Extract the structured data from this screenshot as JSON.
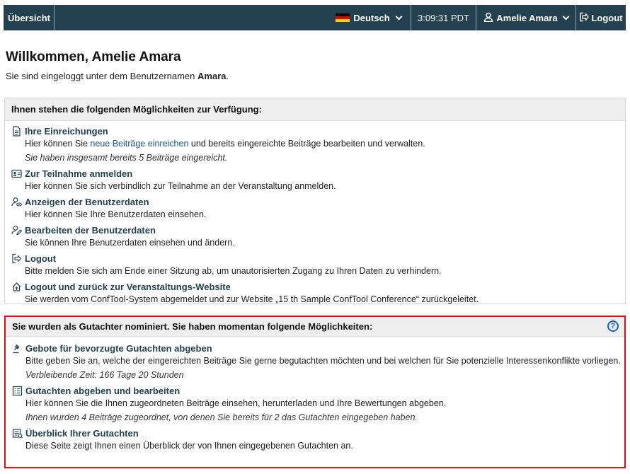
{
  "nav": {
    "home_label": "Übersicht",
    "language_label": "Deutsch",
    "time": "3:09:31 PDT",
    "user_label": "Amelie Amara",
    "logout_label": "Logout",
    "flag_colors": [
      "#000000",
      "#dd0000",
      "#ffce00"
    ]
  },
  "welcome": {
    "title": "Willkommen, Amelie Amara",
    "sub_prefix": "Sie sind eingeloggt unter dem Benutzernamen ",
    "username": "Amara",
    "sub_suffix": "."
  },
  "options_panel": {
    "heading": "Ihnen stehen die folgenden Möglichkeiten zur Verfügung:",
    "items": [
      {
        "icon": "document-icon",
        "title": "Ihre Einreichungen",
        "desc_prefix": "Hier können Sie ",
        "desc_link": "neue Beiträge einreichen",
        "desc_suffix": " und bereits eingereichte Beiträge bearbeiten und verwalten.",
        "note": "Sie haben insgesamt bereits 5 Beiträge eingereicht."
      },
      {
        "icon": "id-card-icon",
        "title": "Zur Teilnahme anmelden",
        "desc": "Hier können Sie sich verbindlich zur Teilnahme an der Veranstaltung anmelden."
      },
      {
        "icon": "user-view-icon",
        "title": "Anzeigen der Benutzerdaten",
        "desc": "Hier können Sie Ihre Benutzerdaten einsehen."
      },
      {
        "icon": "user-edit-icon",
        "title": "Bearbeiten der Benutzerdaten",
        "desc": "Sie können Ihre Benutzerdaten einsehen und ändern."
      },
      {
        "icon": "logout-icon",
        "title": "Logout",
        "desc": "Bitte melden Sie sich am Ende einer Sitzung ab, um unautorisierten Zugang zu Ihren Daten zu verhindern."
      },
      {
        "icon": "home-exit-icon",
        "title": "Logout und zurück zur Veranstaltungs-Website",
        "desc": "Sie werden vom ConfTool-System abgemeldet und zur Website „15 th Sample ConfTool Conference“ zurückgeleitet."
      }
    ]
  },
  "reviewer_panel": {
    "heading": "Sie wurden als Gutachter nominiert. Sie haben momentan folgende Möglichkeiten:",
    "help_symbol": "?",
    "items": [
      {
        "icon": "gavel-icon",
        "title": "Gebote für bevorzugte Gutachten abgeben",
        "desc": "Bitte geben Sie an, welche der eingereichten Beiträge Sie gerne begutachten möchten und bei welchen für Sie potenzielle Interessenkonflikte vorliegen.",
        "note": "Verbleibende Zeit: 166 Tage 20 Stunden"
      },
      {
        "icon": "checklist-icon",
        "title": "Gutachten abgeben und bearbeiten",
        "desc": "Hier können Sie die Ihnen zugeordneten Beiträge einsehen, herunterladen und Ihre Bewertungen abgeben.",
        "note": "Ihnen wurden 4 Beiträge zugeordnet, von denen Sie bereits für 2 das Gutachten eingegeben haben."
      },
      {
        "icon": "review-overview-icon",
        "title": "Überblick Ihrer Gutachten",
        "desc": "Diese Seite zeigt Ihnen einen Überblick der von Ihnen eingegebenen Gutachten an."
      }
    ]
  }
}
